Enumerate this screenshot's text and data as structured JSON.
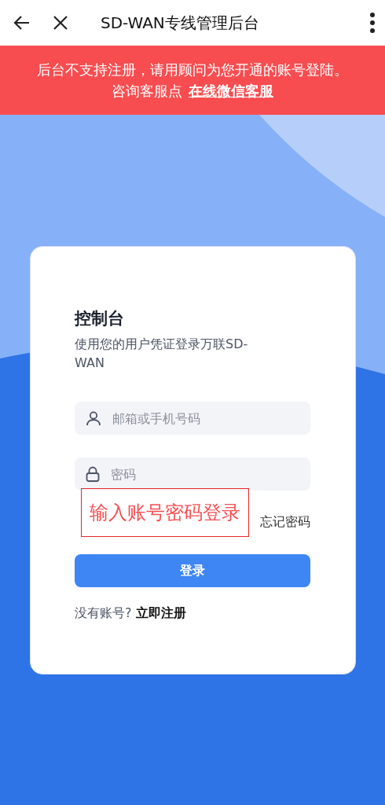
{
  "top_bar": {
    "title": "SD-WAN专线管理后台"
  },
  "notice": {
    "text": "后台不支持注册，请用顾问为您开通的账号登陆。咨询客服点",
    "link": "在线微信客服"
  },
  "login_card": {
    "title": "控制台",
    "subtitle": "使用您的用户凭证登录万联SD-WAN",
    "fields": [
      {
        "kind": "account",
        "placeholder": "邮箱或手机号码"
      },
      {
        "kind": "password",
        "placeholder": "密码"
      }
    ],
    "forgot": "忘记密码",
    "annotation": "输入账号密码登录",
    "submit": "登录",
    "register_prompt": "没有账号?",
    "register_link": "立即注册"
  }
}
